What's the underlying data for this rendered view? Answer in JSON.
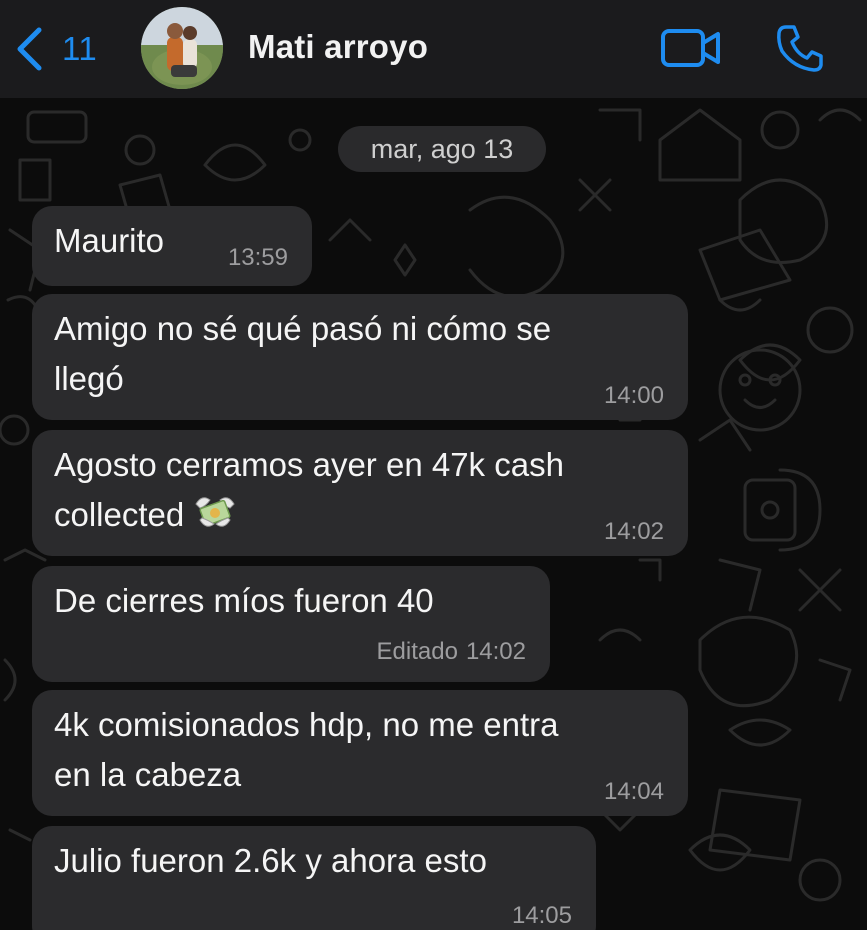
{
  "header": {
    "back_count": "11",
    "contact_name": "Mati arroyo",
    "icons": [
      "chevron-left-icon",
      "video-camera-icon",
      "phone-icon"
    ]
  },
  "chat": {
    "date_separator": "mar, ago 13",
    "messages": [
      {
        "lines": [
          "Maurito"
        ],
        "time": "13:59",
        "edited": ""
      },
      {
        "lines": [
          "Amigo no sé qué pasó ni cómo se",
          "llegó"
        ],
        "time": "14:00",
        "edited": ""
      },
      {
        "lines": [
          "Agosto cerramos ayer en 47k cash",
          "collected"
        ],
        "time": "14:02",
        "edited": "",
        "emoji": "money-with-wings-icon"
      },
      {
        "lines": [
          "De cierres míos fueron 40"
        ],
        "time": "14:02",
        "edited": "Editado"
      },
      {
        "lines": [
          "4k comisionados hdp, no me entra",
          "en la cabeza"
        ],
        "time": "14:04",
        "edited": ""
      },
      {
        "lines": [
          "Julio fueron 2.6k y ahora esto"
        ],
        "time": "14:05",
        "edited": ""
      }
    ]
  },
  "colors": {
    "accent": "#1e8cf0",
    "header_bg": "#1b1b1d",
    "bubble_bg": "#2b2b2d",
    "chat_bg": "#0c0c0c",
    "timestamp": "#9d9d9f"
  }
}
